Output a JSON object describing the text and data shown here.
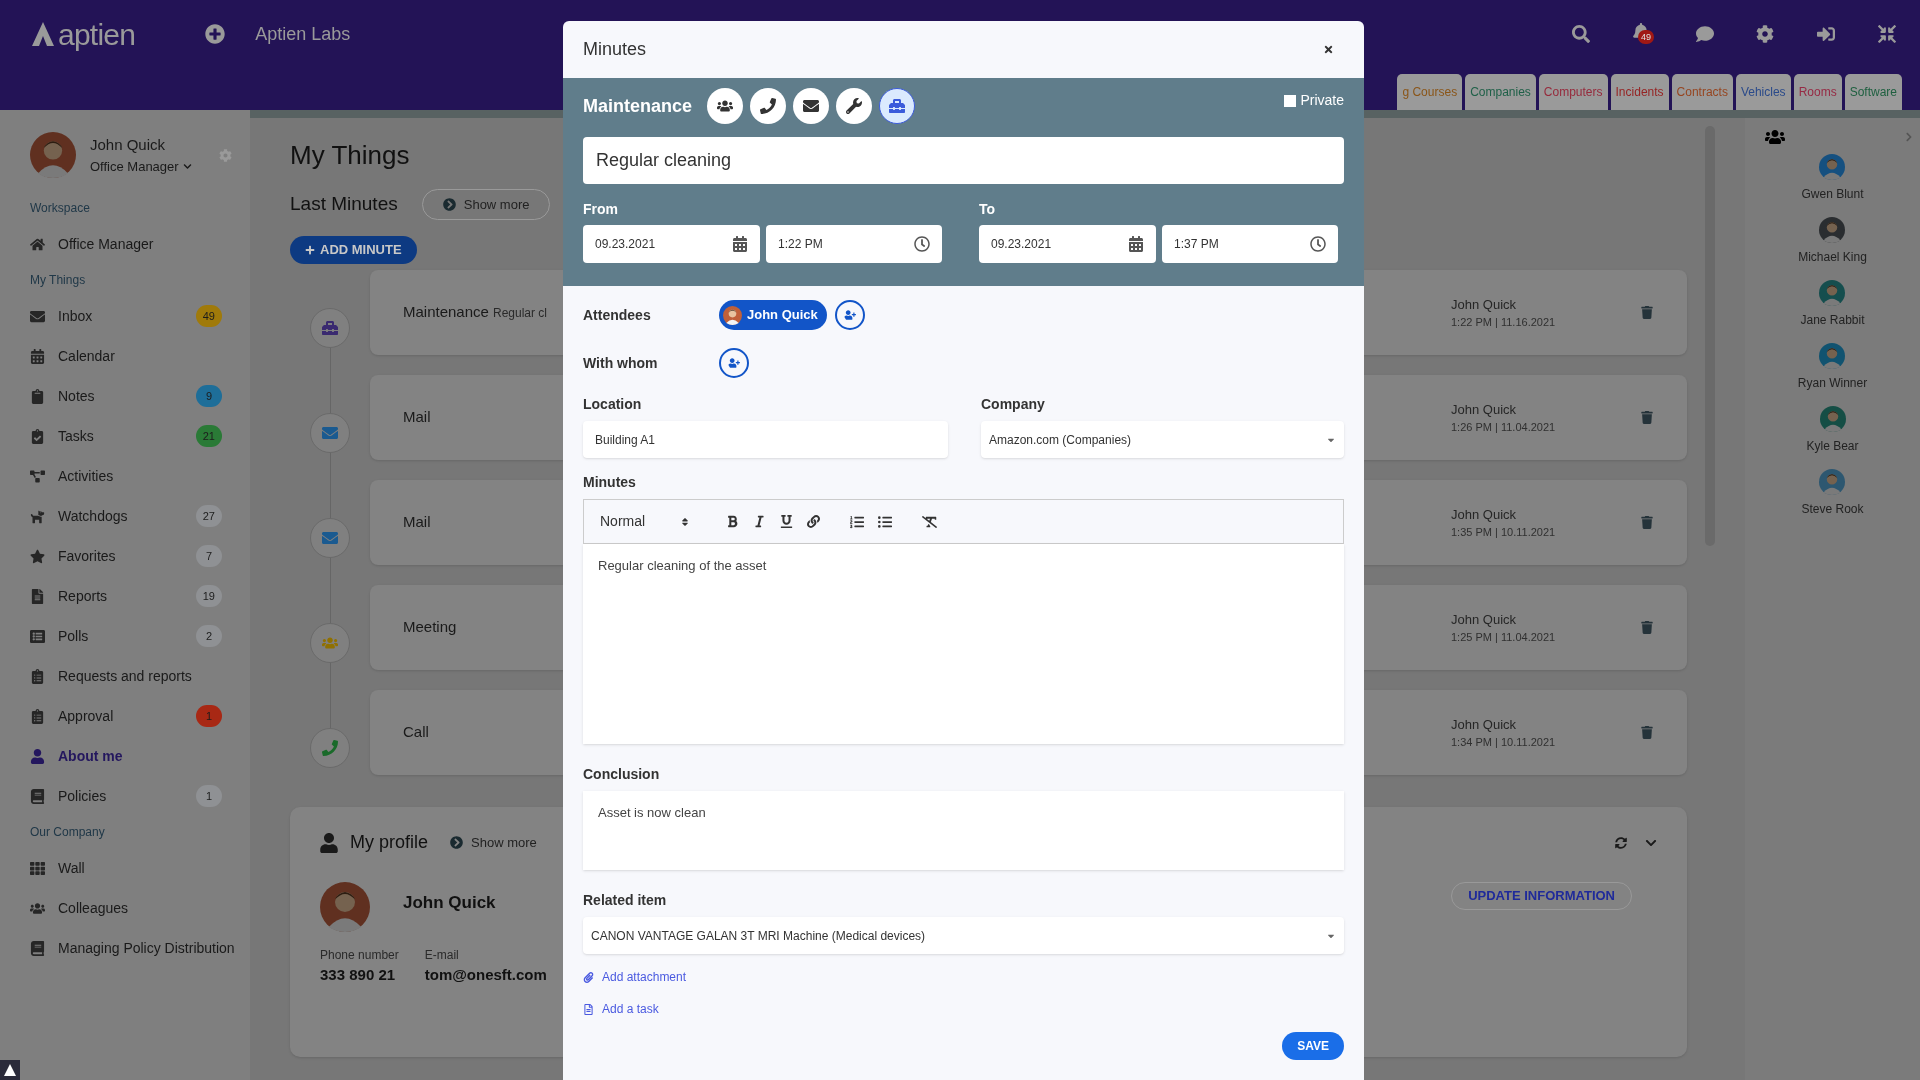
{
  "app": {
    "logo": "aptien",
    "organization": "Aptien Labs",
    "notifications": "49"
  },
  "tabs": [
    {
      "label": "g Courses"
    },
    {
      "label": "Companies"
    },
    {
      "label": "Computers"
    },
    {
      "label": "Incidents"
    },
    {
      "label": "Contracts"
    },
    {
      "label": "Vehicles"
    },
    {
      "label": "Rooms"
    },
    {
      "label": "Software"
    }
  ],
  "sidebar": {
    "user": {
      "name": "John Quick",
      "role": "Office Manager"
    },
    "sections": [
      {
        "title": "Workspace",
        "items": [
          {
            "label": "Office Manager",
            "selected": false
          }
        ]
      },
      {
        "title": "My Things",
        "items": [
          {
            "label": "Inbox",
            "badge": "49",
            "color": "#a07a0a",
            "selected": false
          },
          {
            "label": "Calendar",
            "selected": false
          },
          {
            "label": "Notes",
            "badge": "9",
            "color": "#1e6e99",
            "selected": false
          },
          {
            "label": "Tasks",
            "badge": "21",
            "color": "#2a7a36",
            "selected": false
          },
          {
            "label": "Activities",
            "selected": false
          },
          {
            "label": "Watchdogs",
            "badge": "27",
            "color": "#8f9194",
            "selected": false
          },
          {
            "label": "Favorites",
            "badge": "7",
            "color": "#8f9194",
            "selected": false
          },
          {
            "label": "Reports",
            "badge": "19",
            "color": "#8f9194",
            "selected": false
          },
          {
            "label": "Polls",
            "badge": "2",
            "color": "#8f9194",
            "selected": false
          },
          {
            "label": "Requests and reports",
            "selected": false
          },
          {
            "label": "Approval",
            "badge": "1",
            "color": "#a82814",
            "selected": false
          },
          {
            "label": "About me",
            "selected": true
          },
          {
            "label": "Policies",
            "badge": "1",
            "color": "#8f9194",
            "selected": false
          }
        ]
      },
      {
        "title": "Our Company",
        "items": [
          {
            "label": "Wall",
            "selected": false
          },
          {
            "label": "Colleagues",
            "selected": false
          },
          {
            "label": "Managing Policy Distribution",
            "selected": false
          }
        ]
      }
    ]
  },
  "page": {
    "title": "My Things",
    "last_minutes": {
      "title": "Last Minutes",
      "show_more": "Show more",
      "add_button": "ADD MINUTE",
      "items": [
        {
          "kind": "maintenance",
          "title": "Maintenance",
          "excerpt": "Regular cl",
          "author": "John Quick",
          "time": "1:22 PM | 11.16.2021"
        },
        {
          "kind": "mail",
          "title": "Mail",
          "author": "John Quick",
          "time": "1:26 PM | 11.04.2021"
        },
        {
          "kind": "mail",
          "title": "Mail",
          "author": "John Quick",
          "time": "1:35 PM | 10.11.2021"
        },
        {
          "kind": "meeting",
          "title": "Meeting",
          "author": "John Quick",
          "time": "1:25 PM | 11.04.2021"
        },
        {
          "kind": "call",
          "title": "Call",
          "author": "John Quick",
          "time": "1:34 PM | 10.11.2021"
        }
      ]
    },
    "profile": {
      "title": "My profile",
      "show_more": "Show more",
      "name": "John Quick",
      "update_button": "UPDATE INFORMATION",
      "fields": [
        {
          "label": "Phone number",
          "value": "333 890 21"
        },
        {
          "label": "E-mail",
          "value": "tom@onesft.com"
        }
      ]
    }
  },
  "colleagues": [
    {
      "name": "Gwen Blunt"
    },
    {
      "name": "Michael King"
    },
    {
      "name": "Jane Rabbit"
    },
    {
      "name": "Ryan Winner"
    },
    {
      "name": "Kyle Bear"
    },
    {
      "name": "Steve Rook"
    }
  ],
  "modal": {
    "title": "Minutes",
    "type_label": "Maintenance",
    "types": [
      {
        "kind": "meeting",
        "selected": false
      },
      {
        "kind": "call",
        "selected": false
      },
      {
        "kind": "mail",
        "selected": false
      },
      {
        "kind": "repair",
        "selected": false
      },
      {
        "kind": "maintenance",
        "selected": true
      }
    ],
    "private": {
      "label": "Private",
      "checked": false
    },
    "subject": "Regular cleaning",
    "from": {
      "label": "From",
      "date": "09.23.2021",
      "time": "1:22 PM"
    },
    "to": {
      "label": "To",
      "date": "09.23.2021",
      "time": "1:37 PM"
    },
    "attendees": {
      "label": "Attendees",
      "people": [
        "John Quick"
      ]
    },
    "with_whom": {
      "label": "With whom"
    },
    "location": {
      "label": "Location",
      "value": "Building A1"
    },
    "company": {
      "label": "Company",
      "value": "Amazon.com (Companies)"
    },
    "minutes": {
      "label": "Minutes",
      "format": "Normal",
      "content": "Regular cleaning of the asset"
    },
    "conclusion": {
      "label": "Conclusion",
      "value": "Asset is now clean"
    },
    "related_item": {
      "label": "Related item",
      "value": "CANON VANTAGE GALAN 3T MRI Machine (Medical devices)"
    },
    "links": [
      {
        "kind": "attachment",
        "label": "Add attachment"
      },
      {
        "kind": "task",
        "label": "Add a task"
      }
    ],
    "save": "SAVE"
  }
}
